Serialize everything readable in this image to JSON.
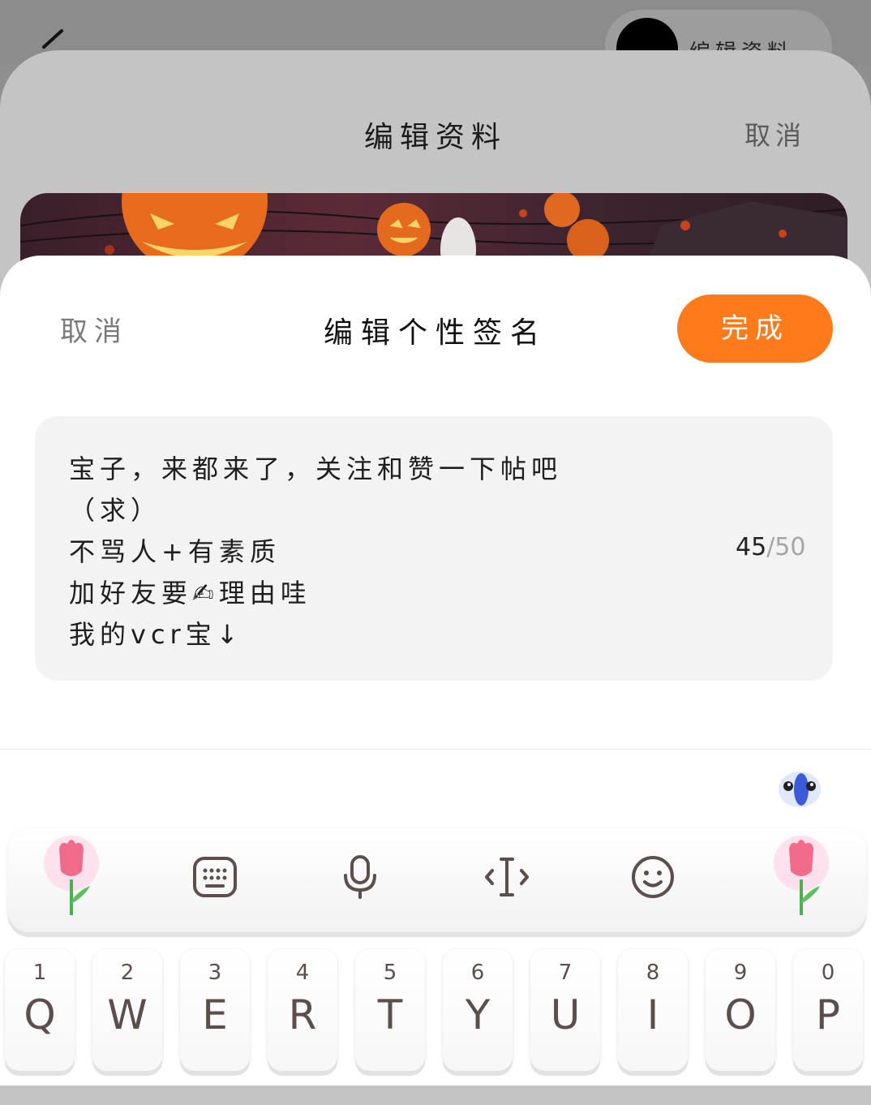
{
  "background": {
    "chip_label": "编辑资料",
    "sheet_title": "编辑资料",
    "sheet_cancel": "取消"
  },
  "editor": {
    "cancel_label": "取消",
    "title": "编辑个性签名",
    "done_label": "完成",
    "signature_lines": [
      "宝子，来都来了，关注和赞一下帖吧",
      "（求）",
      "不骂人+有素质",
      "加好友要✍理由哇",
      "我的vcr宝↓"
    ],
    "count": "45",
    "count_max": "/50"
  },
  "keyboard": {
    "toolbar_icons": [
      "tulip-icon",
      "keyboard-icon",
      "microphone-icon",
      "cursor-icon",
      "emoji-icon",
      "tulip-icon"
    ],
    "keys": [
      {
        "num": "1",
        "letter": "Q"
      },
      {
        "num": "2",
        "letter": "W"
      },
      {
        "num": "3",
        "letter": "E"
      },
      {
        "num": "4",
        "letter": "R"
      },
      {
        "num": "5",
        "letter": "T"
      },
      {
        "num": "6",
        "letter": "Y"
      },
      {
        "num": "7",
        "letter": "U"
      },
      {
        "num": "8",
        "letter": "I"
      },
      {
        "num": "9",
        "letter": "O"
      },
      {
        "num": "0",
        "letter": "P"
      }
    ]
  },
  "colors": {
    "accent": "#ff7a1a",
    "key_text": "#5b4e4b"
  }
}
